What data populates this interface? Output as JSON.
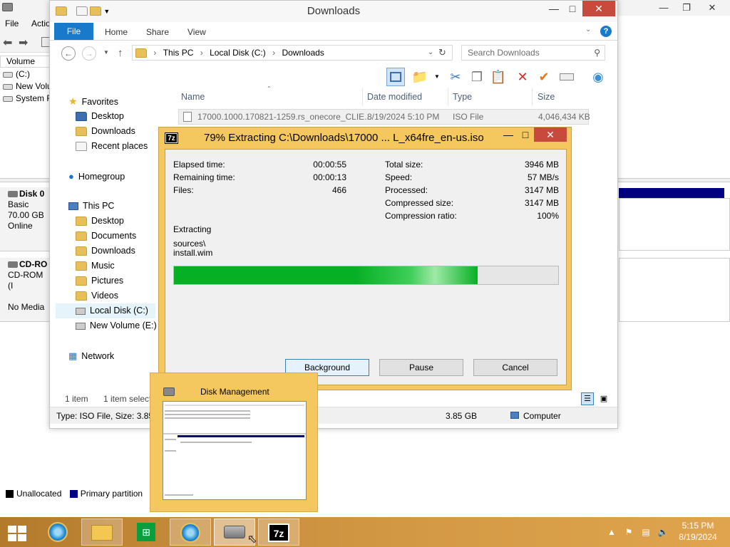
{
  "disk_management": {
    "menu": [
      "File",
      "Actio"
    ],
    "volume_header": "Volume",
    "volumes": [
      "(C:)",
      "New Volu",
      "System R"
    ],
    "disks": [
      {
        "name": "Disk 0",
        "lines": [
          "Basic",
          "70.00 GB",
          "Online"
        ]
      },
      {
        "name": "CD-RO",
        "lines": [
          "CD-ROM (I",
          "",
          "No Media"
        ]
      }
    ],
    "legend": [
      {
        "label": "Unallocated",
        "color": "#000000"
      },
      {
        "label": "Primary partition",
        "color": "#000080"
      }
    ]
  },
  "explorer": {
    "title": "Downloads",
    "ribbon_tabs": [
      "File",
      "Home",
      "Share",
      "View"
    ],
    "address": [
      "This PC",
      "Local Disk (C:)",
      "Downloads"
    ],
    "search_placeholder": "Search Downloads",
    "nav": {
      "favorites": "Favorites",
      "favorites_items": [
        "Desktop",
        "Downloads",
        "Recent places"
      ],
      "homegroup": "Homegroup",
      "this_pc": "This PC",
      "this_pc_items": [
        "Desktop",
        "Documents",
        "Downloads",
        "Music",
        "Pictures",
        "Videos",
        "Local Disk (C:)",
        "New Volume (E:)"
      ],
      "network": "Network"
    },
    "columns": [
      "Name",
      "Date modified",
      "Type",
      "Size"
    ],
    "file": {
      "name": "17000.1000.170821-1259.rs_onecore_CLIE...",
      "date": "8/19/2024 5:10 PM",
      "type": "ISO File",
      "size": "4,046,434 KB"
    },
    "status_count": "1 item",
    "status_selected": "1 item select",
    "details_text": "Type: ISO File, Size: 3.85 G",
    "details_size": "3.85 GB",
    "details_location": "Computer"
  },
  "zip_dialog": {
    "title": "79% Extracting C:\\Downloads\\17000 ... L_x64fre_en-us.iso",
    "icon_text": "7z",
    "left_stats": [
      {
        "label": "Elapsed time:",
        "value": "00:00:55"
      },
      {
        "label": "Remaining time:",
        "value": "00:00:13"
      },
      {
        "label": "Files:",
        "value": "466"
      }
    ],
    "right_stats": [
      {
        "label": "Total size:",
        "value": "3946 MB"
      },
      {
        "label": "Speed:",
        "value": "57 MB/s"
      },
      {
        "label": "Processed:",
        "value": "3147 MB"
      },
      {
        "label": "Compressed size:",
        "value": "3147 MB"
      },
      {
        "label": "Compression ratio:",
        "value": "100%"
      }
    ],
    "action": "Extracting",
    "path_line1": "sources\\",
    "path_line2": "install.wim",
    "progress": 0.79,
    "buttons": [
      "Background",
      "Pause",
      "Cancel"
    ]
  },
  "thumbnail": {
    "title": "Disk Management"
  },
  "taskbar": {
    "time": "5:15 PM",
    "date": "8/19/2024",
    "icons": [
      "internet-explorer-icon",
      "file-explorer-icon",
      "store-icon",
      "internet-explorer-icon",
      "disk-management-icon",
      "7zip-icon"
    ]
  }
}
